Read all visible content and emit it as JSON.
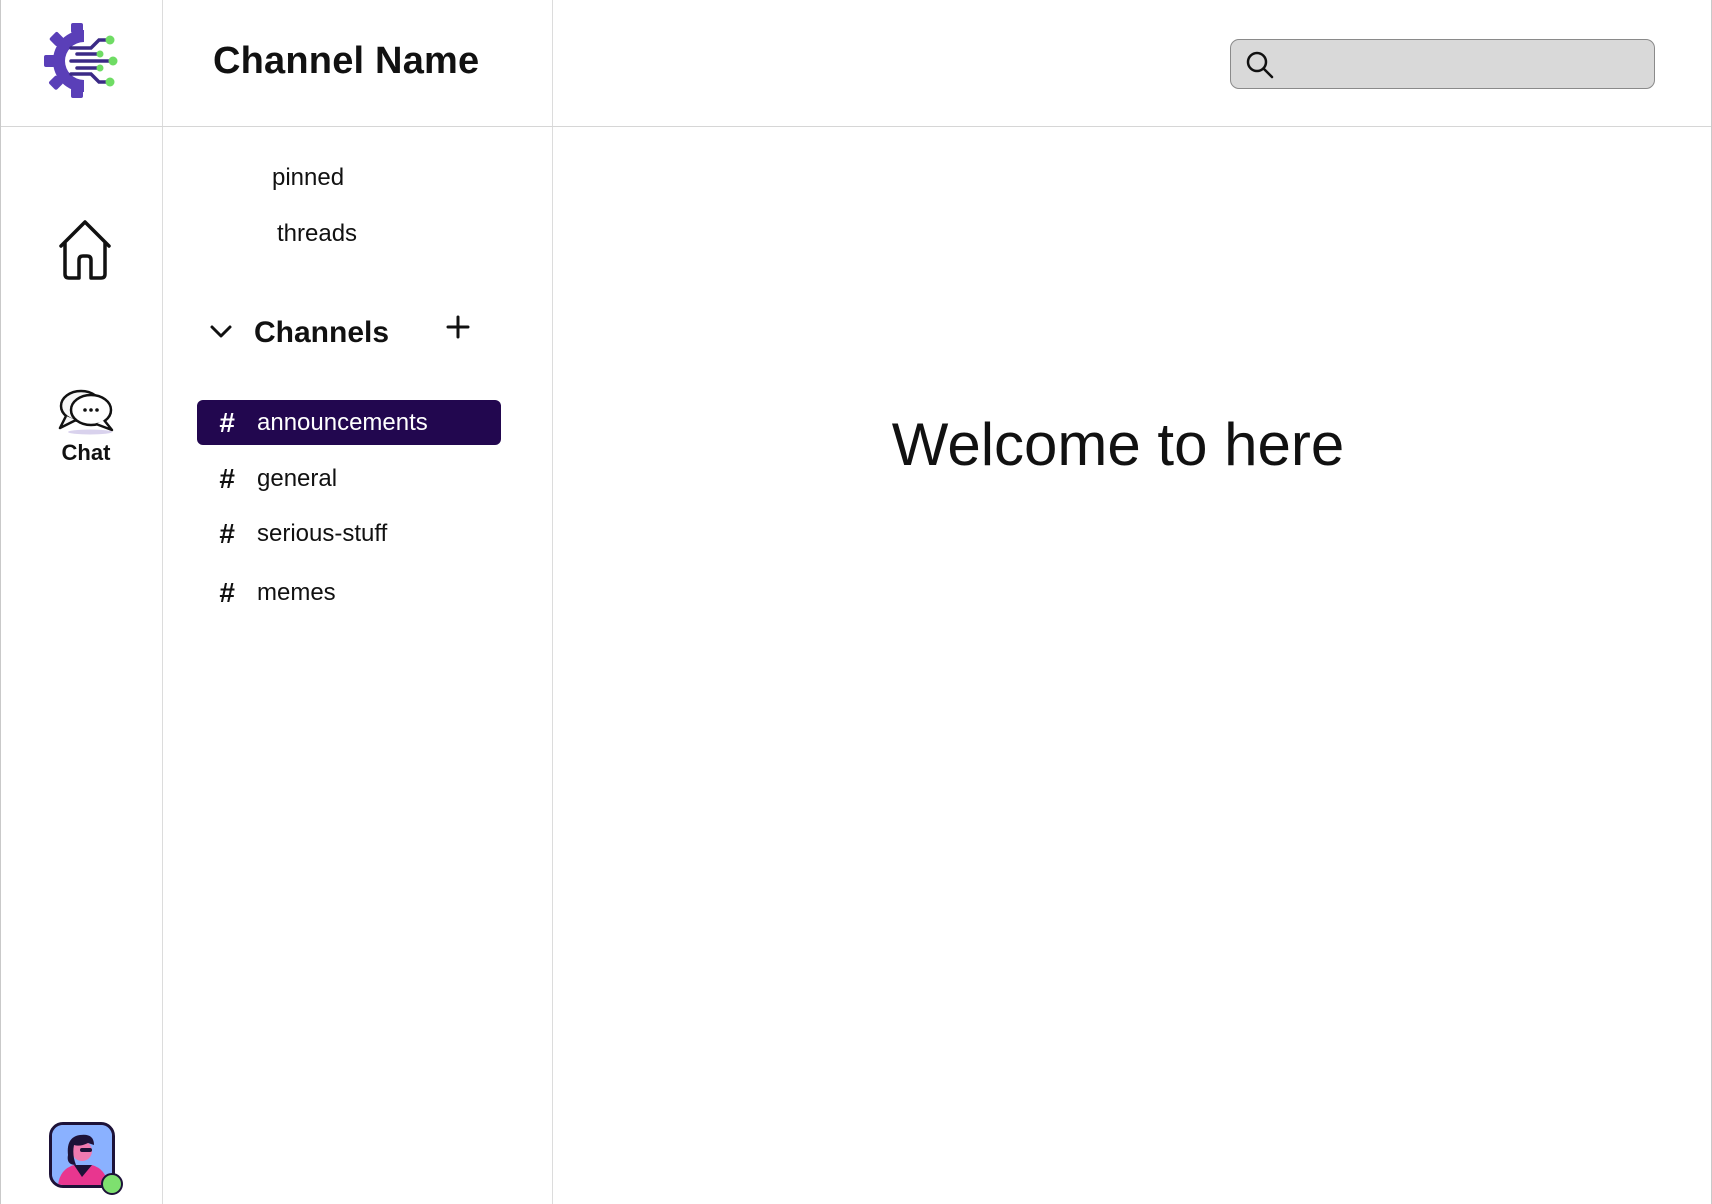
{
  "header": {
    "channel_title": "Channel Name",
    "search": {
      "placeholder": "",
      "value": "",
      "icon": "search-icon"
    }
  },
  "rail": {
    "logo_icon": "gear-circuit-logo-icon",
    "home": {
      "icon": "home-icon"
    },
    "chat": {
      "icon": "chat-bubbles-icon",
      "label": "Chat"
    },
    "user": {
      "icon": "user-avatar",
      "status": "online",
      "status_color": "#7ee06f"
    }
  },
  "sidebar": {
    "links": [
      {
        "label": "pinned"
      },
      {
        "label": "threads"
      }
    ],
    "channels_section": {
      "label": "Channels",
      "expanded": true,
      "add_icon": "plus-icon",
      "items": [
        {
          "prefix": "#",
          "name": "announcements",
          "active": true
        },
        {
          "prefix": "#",
          "name": "general",
          "active": false
        },
        {
          "prefix": "#",
          "name": "serious-stuff",
          "active": false
        },
        {
          "prefix": "#",
          "name": "memes",
          "active": false
        }
      ]
    }
  },
  "main": {
    "welcome_text": "Welcome to here"
  },
  "colors": {
    "active_channel_bg": "#22074f",
    "logo_primary": "#5a3fb8",
    "logo_accent": "#6fdc64",
    "search_bg": "#d9d9d9"
  }
}
